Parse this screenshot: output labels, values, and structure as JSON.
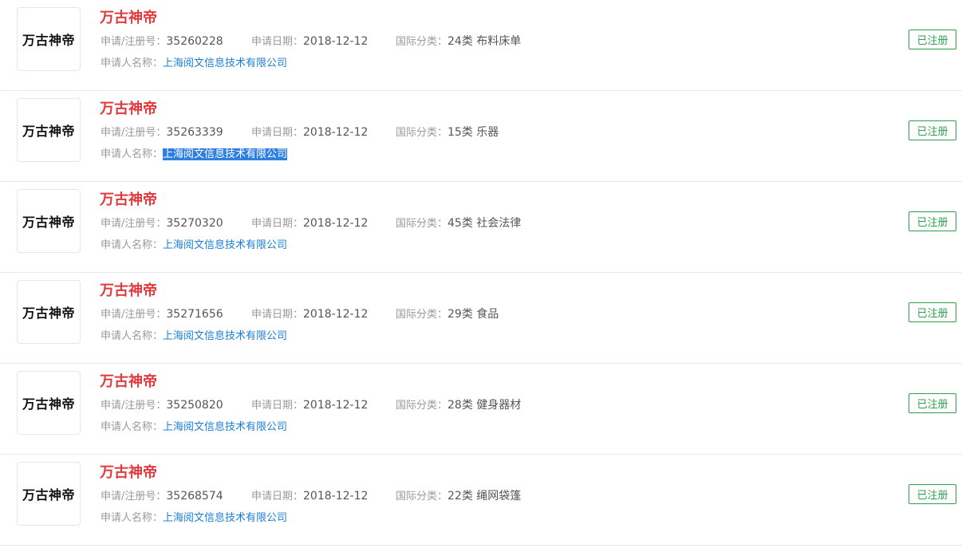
{
  "labels": {
    "reg_no": "申请/注册号：",
    "apply_date": "申请日期：",
    "intl_class": "国际分类：",
    "applicant": "申请人名称："
  },
  "colors": {
    "title": "#e03a3e",
    "link": "#1a7fd4",
    "status": "#2e9e4f",
    "selection": "#2f7fe0"
  },
  "items": [
    {
      "logo_text": "万古神帝",
      "title": "万古神帝",
      "reg_no": "35260228",
      "apply_date": "2018-12-12",
      "intl_class": "24类 布料床单",
      "applicant": "上海阅文信息技术有限公司",
      "status": "已注册"
    },
    {
      "logo_text": "万古神帝",
      "title": "万古神帝",
      "reg_no": "35263339",
      "apply_date": "2018-12-12",
      "intl_class": "15类 乐器",
      "applicant": "上海阅文信息技术有限公司",
      "status": "已注册",
      "applicant_selected": true
    },
    {
      "logo_text": "万古神帝",
      "title": "万古神帝",
      "reg_no": "35270320",
      "apply_date": "2018-12-12",
      "intl_class": "45类 社会法律",
      "applicant": "上海阅文信息技术有限公司",
      "status": "已注册"
    },
    {
      "logo_text": "万古神帝",
      "title": "万古神帝",
      "reg_no": "35271656",
      "apply_date": "2018-12-12",
      "intl_class": "29类 食品",
      "applicant": "上海阅文信息技术有限公司",
      "status": "已注册"
    },
    {
      "logo_text": "万古神帝",
      "title": "万古神帝",
      "reg_no": "35250820",
      "apply_date": "2018-12-12",
      "intl_class": "28类 健身器材",
      "applicant": "上海阅文信息技术有限公司",
      "status": "已注册"
    },
    {
      "logo_text": "万古神帝",
      "title": "万古神帝",
      "reg_no": "35268574",
      "apply_date": "2018-12-12",
      "intl_class": "22类 绳网袋篷",
      "applicant": "上海阅文信息技术有限公司",
      "status": "已注册"
    }
  ]
}
